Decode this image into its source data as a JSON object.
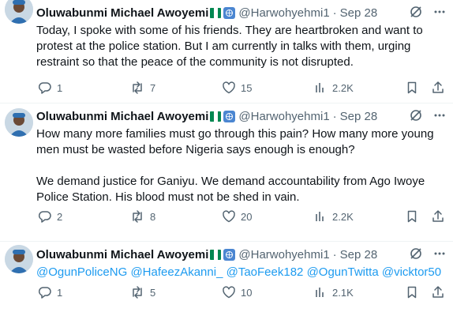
{
  "tweets": [
    {
      "author_name": "Oluwabunmi Michael Awoyemi",
      "handle": "@Harwohyehmi1",
      "separator": "·",
      "date": "Sep 28",
      "text": "Today, I spoke with some of his friends. They are heartbroken and want to protest at the police station. But I am currently in talks with them, urging restraint so that the peace of the community is not disrupted.",
      "replies": "1",
      "reposts": "7",
      "likes": "15",
      "views": "2.2K"
    },
    {
      "author_name": "Oluwabunmi Michael Awoyemi",
      "handle": "@Harwohyehmi1",
      "separator": "·",
      "date": "Sep 28",
      "text": "How many more families must go through this pain? How many more young men must be wasted before Nigeria says enough is enough?\n\nWe demand justice for Ganiyu. We demand accountability from Ago Iwoye Police Station. His blood must not be shed in vain.",
      "replies": "2",
      "reposts": "8",
      "likes": "20",
      "views": "2.2K"
    },
    {
      "author_name": "Oluwabunmi Michael Awoyemi",
      "handle": "@Harwohyehmi1",
      "separator": "·",
      "date": "Sep 28",
      "mentions": [
        "@OgunPoliceNG",
        "@HafeezAkanni_",
        "@TaoFeek182",
        "@OgunTwitta",
        "@vicktor50"
      ],
      "replies": "1",
      "reposts": "5",
      "likes": "10",
      "views": "2.1K"
    }
  ],
  "colors": {
    "text": "#0f1419",
    "secondary": "#536471",
    "link": "#1d9bf0",
    "flag_green": "#008751",
    "un_blue": "#4b86d1"
  },
  "icons": [
    "avatar",
    "nigeria-flag",
    "un-badge",
    "grok-icon",
    "more-icon",
    "reply-icon",
    "repost-icon",
    "like-icon",
    "views-icon",
    "bookmark-icon",
    "share-icon"
  ]
}
